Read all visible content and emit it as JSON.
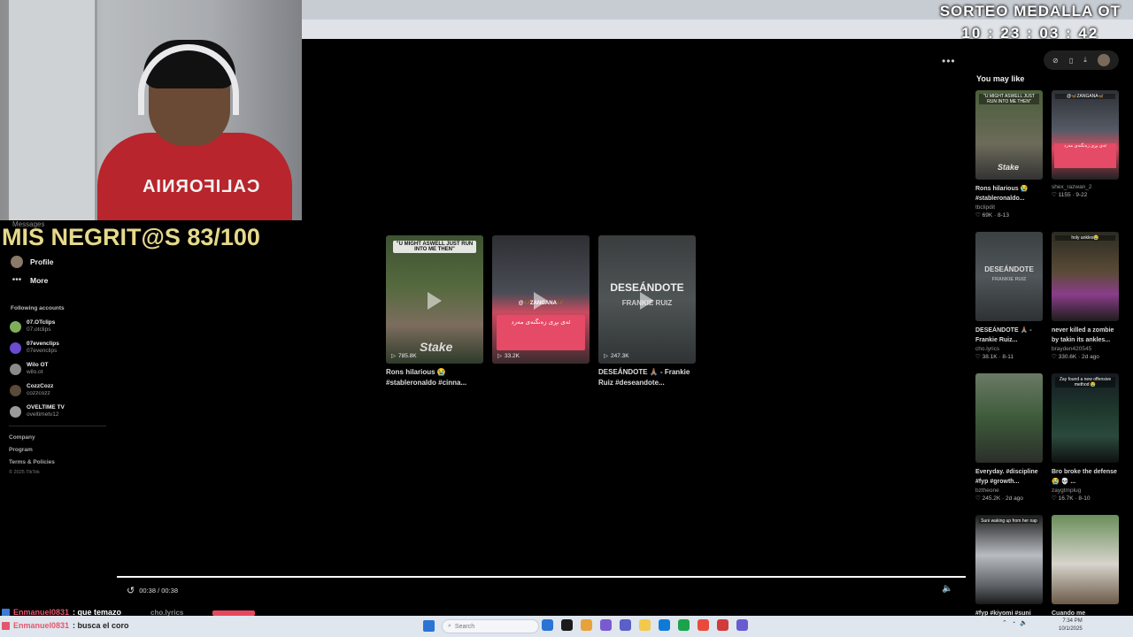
{
  "overlay": {
    "sorteo_title": "SORTEO MEDALLA OT",
    "sorteo_timer": "10 : 23 : 03 : 42",
    "counter_text": "MIS NEGRIT@S 83/100"
  },
  "webcam": {
    "shirt_text": "CALIFORNIA"
  },
  "sidebar": {
    "messages_label": "Messages",
    "profile_label": "Profile",
    "more_label": "More",
    "following_title": "Following accounts",
    "following": [
      {
        "name": "07.OTclips",
        "handle": "07.otclips",
        "color": "#7fae5a"
      },
      {
        "name": "07evenclips",
        "handle": "07evenclips",
        "color": "#6a4bd1"
      },
      {
        "name": "Wilo OT",
        "handle": "wilo.ot",
        "color": "#8a8a8a"
      },
      {
        "name": "CozzCozz",
        "handle": "cozzcozz",
        "color": "#5a4a3a"
      },
      {
        "name": "OVELTIME TV",
        "handle": "oveltimetv12",
        "color": "#9a9a9a"
      }
    ],
    "footer": {
      "company": "Company",
      "program": "Program",
      "terms": "Terms & Policies",
      "copyright": "© 2025 TikTok"
    }
  },
  "main": {
    "more_glyph": "•••",
    "videos": [
      {
        "title": "Rons hilarious 😭 #stableronaldo #cinna...",
        "views": "785.8K",
        "caption": "\"U MIGHT ASWELL JUST RUN INTO ME THEN\"",
        "watermark": "Stake"
      },
      {
        "title": "",
        "views": "33.2K",
        "caption": "@🦋ZANGANA🦋",
        "overlay": "ئەی بڕی زەنگنەی مەرد"
      },
      {
        "title": "DESEÁNDOTE 🙏🏽 - Frankie Ruiz #deseandote...",
        "views": "247.3K",
        "big": "DESEÁNDOTE",
        "sub": "FRANKIE RUIZ"
      }
    ],
    "player": {
      "time": "00:38 / 00:38"
    }
  },
  "rail": {
    "title": "You may like",
    "items": [
      {
        "title": "Rons hilarious 😭 #stableronaldo...",
        "author": "tbclipdit",
        "likes": "69K",
        "date": "8-13",
        "cap": "\"U MIGHT ASWELL JUST RUN INTO ME THEN\"",
        "watermark": "Stake"
      },
      {
        "title": "",
        "author": "shex_razwan_2",
        "likes": "1155",
        "date": "9-22",
        "cap": "@🦋ZANGANA🦋",
        "overlay": "ئەی بڕی زەنگنەی مەرد"
      },
      {
        "title": "DESEÁNDOTE 🙏🏽 - Frankie Ruiz...",
        "author": "cho.lyrics",
        "likes": "38.1K",
        "date": "8-11",
        "big": "DESEÁNDOTE",
        "sub": "FRANKIE RUIZ"
      },
      {
        "title": "never killed a zombie by takin its ankles...",
        "author": "brayden420545",
        "likes": "330.6K",
        "date": "2d ago",
        "cap": "holy ankles😭"
      },
      {
        "title": "Everyday. #discipline #fyp #growth...",
        "author": "bztheone",
        "likes": "245.2K",
        "date": "2d ago",
        "cap": ""
      },
      {
        "title": "Bro broke the defense 😭 💀 ...",
        "author": "zaygtmplug",
        "likes": "16.7K",
        "date": "8-10",
        "cap": "Zay found a new offensive method 😭"
      },
      {
        "title": "#fyp #kiyomi #suni",
        "author": "",
        "likes": "",
        "date": "",
        "cap": "Suni waking up from her nap"
      },
      {
        "title": "Cuando me",
        "author": "",
        "likes": "",
        "date": "",
        "cap": ""
      }
    ]
  },
  "chat": [
    {
      "name": "Enmanuel0831",
      "message": ": que temazo"
    },
    {
      "name": "Enmanuel0831",
      "message": ": busca el coro"
    }
  ],
  "behind_tab": "cho.lyrics",
  "taskbar": {
    "search_placeholder": "Search",
    "clock_time": "7:34 PM",
    "clock_date": "10/1/2025",
    "apps": [
      "#2a74d6",
      "#1b1b1b",
      "#e8a23a",
      "#7a5ad1",
      "#5b5fc7",
      "#f2c94c",
      "#0f7bd8",
      "#1ba34b",
      "#e84b3c",
      "#d13b3b",
      "#6a5ad1"
    ]
  },
  "colors": {
    "accent": "#e4566b",
    "counter": "#e6d98a"
  }
}
